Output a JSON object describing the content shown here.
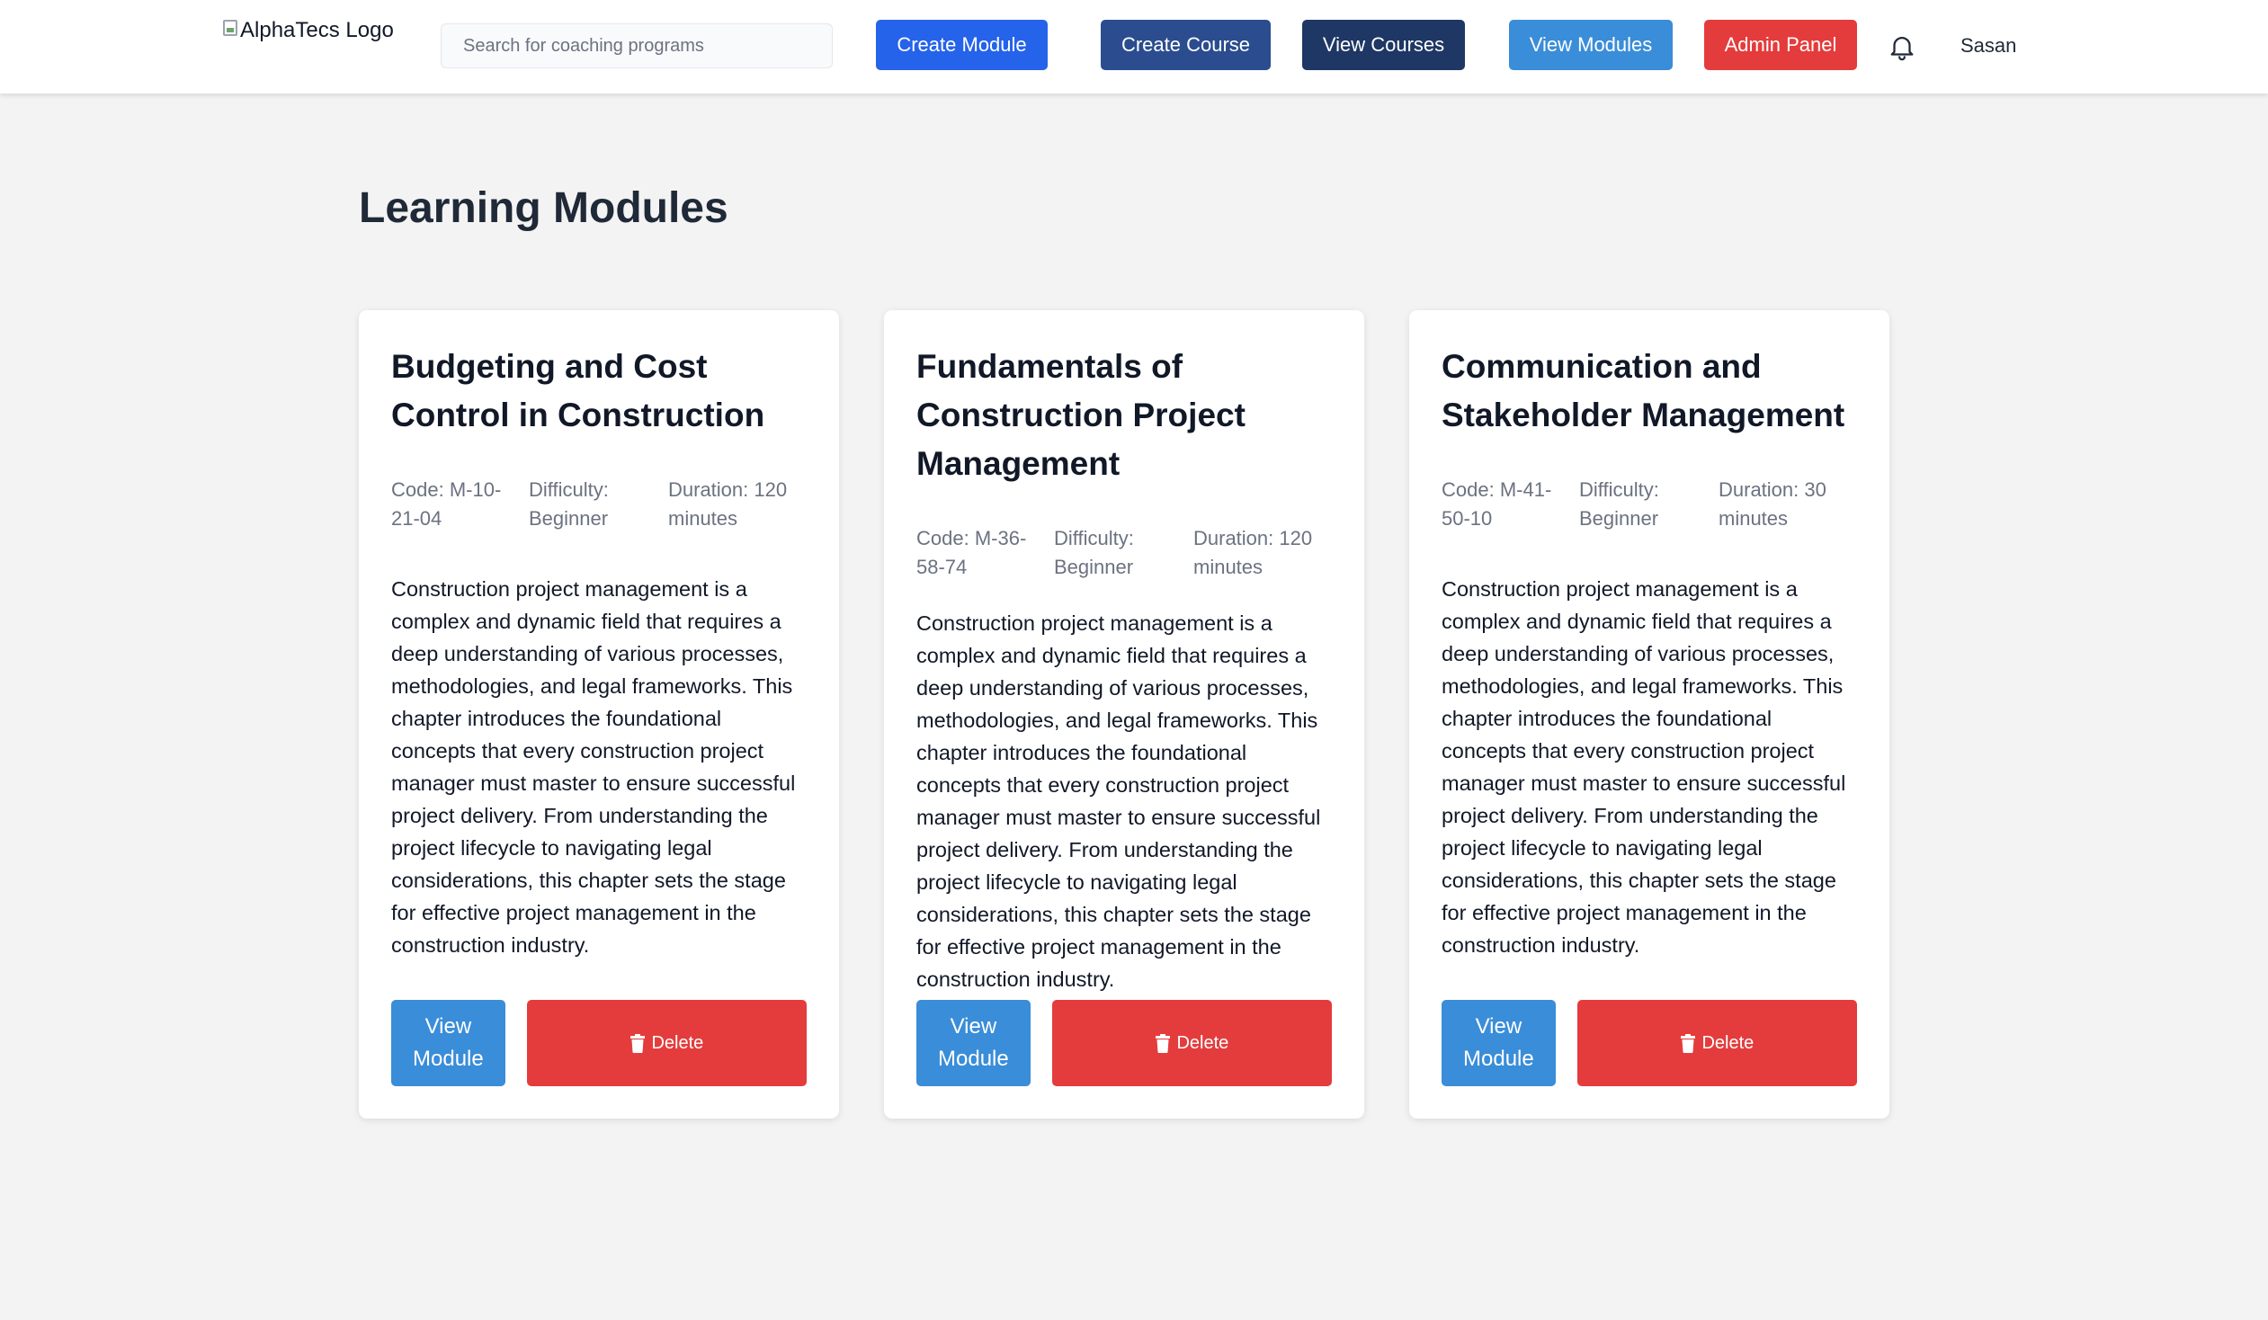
{
  "header": {
    "logo_alt": "AlphaTecs Logo",
    "search_placeholder": "Search for coaching programs",
    "nav": {
      "create_module": "Create Module",
      "create_course": "Create Course",
      "view_courses": "View Courses",
      "view_modules": "View Modules",
      "admin_panel": "Admin Panel"
    },
    "username": "Sasan"
  },
  "main": {
    "title": "Learning Modules",
    "modules": [
      {
        "title": "Budgeting and Cost Control in Construction",
        "code": "Code: M-10-21-04",
        "difficulty": "Difficulty: Beginner",
        "duration": "Duration: 120 minutes",
        "description": "Construction project management is a complex and dynamic field that requires a deep understanding of various processes, methodologies, and legal frameworks. This chapter introduces the foundational concepts that every construction project manager must master to ensure successful project delivery. From understanding the project lifecycle to navigating legal considerations, this chapter sets the stage for effective project management in the construction industry.",
        "view_label": "View Module",
        "delete_label": "Delete"
      },
      {
        "title": "Fundamentals of Construction Project Management",
        "code": "Code: M-36-58-74",
        "difficulty": "Difficulty: Beginner",
        "duration": "Duration: 120 minutes",
        "description": "Construction project management is a complex and dynamic field that requires a deep understanding of various processes, methodologies, and legal frameworks. This chapter introduces the foundational concepts that every construction project manager must master to ensure successful project delivery. From understanding the project lifecycle to navigating legal considerations, this chapter sets the stage for effective project management in the construction industry.",
        "view_label": "View Module",
        "delete_label": "Delete"
      },
      {
        "title": "Communication and Stakeholder Management",
        "code": "Code: M-41-50-10",
        "difficulty": "Difficulty: Beginner",
        "duration": "Duration: 30 minutes",
        "description": "Construction project management is a complex and dynamic field that requires a deep understanding of various processes, methodologies, and legal frameworks. This chapter introduces the foundational concepts that every construction project manager must master to ensure successful project delivery. From understanding the project lifecycle to navigating legal considerations, this chapter sets the stage for effective project management in the construction industry.",
        "view_label": "View Module",
        "delete_label": "Delete"
      }
    ]
  },
  "colors": {
    "primary_blue": "#2563eb",
    "navy": "#2b4d8f",
    "dark_navy": "#1e3764",
    "light_blue": "#3a8dd8",
    "danger_red": "#e43c3c",
    "background": "#f3f3f3"
  },
  "icons": {
    "bell": "bell-icon",
    "trash": "trash-icon",
    "broken_image": "broken-image-icon"
  }
}
